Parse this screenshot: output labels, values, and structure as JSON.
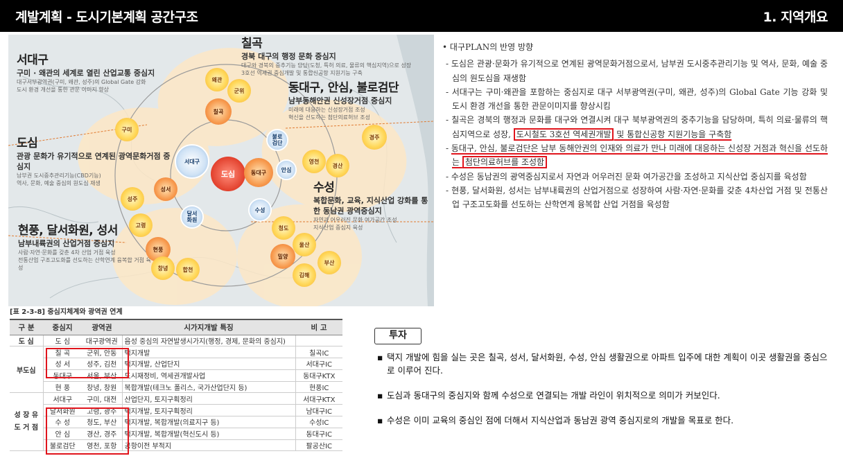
{
  "header": {
    "title": "계발계획 - 도시기본계획 공간구조",
    "section": "1. 지역개요"
  },
  "map": {
    "areas": [
      {
        "title": "서대구",
        "subtitle": "구미 · 왜관의 세계로 열린 산업교통 중심지",
        "notes": [
          "대구서부광역권(구미, 왜관, 성주)의 Global Gate 강화",
          "도시 환경 개선을 통한 관문 이미지 향상"
        ]
      },
      {
        "title": "칠곡",
        "subtitle": "경북 대구의 행정 문화 중심지",
        "notes": [
          "대구와 경북의 중추기능 담당(도청, 특허 의료, 물류의 핵심지역)으로 성장",
          "3호선 역세권 중심개발 및 통합신공항 지원기능 구축"
        ]
      },
      {
        "title": "동대구, 안심, 불로검단",
        "subtitle": "남부동해안권 신성장거점 중심지",
        "notes": [
          "미래에 대응하는 신성장거점 조성",
          "혁신을 선도하는 첨단의료허브 조성"
        ]
      },
      {
        "title": "도심",
        "subtitle": "관광 문화가 유기적으로 연계된 광역문화거점 중심지",
        "notes": [
          "남부권 도시중추관리기능(CBD기능)",
          "역사, 문화, 예술 중심의 원도심 재생"
        ]
      },
      {
        "title": "수성",
        "subtitle": "복합문화, 교육, 지식산업 강화를 통한 동남권 광역중심지",
        "notes": [
          "자연과 어우러진 문화 여가공간 조성",
          "지식산업 중심지 육성"
        ]
      },
      {
        "title": "현풍, 달서화원, 성서",
        "subtitle": "남부내륙권의 산업거점 중심지",
        "notes": [
          "사람·자연·문화를 갖춘 4차 산업 거점 육성",
          "전통산업 구조고도화를 선도하는 산학연계 융복합 거점 육성"
        ]
      }
    ],
    "nodes": {
      "center": "도심",
      "dongdaegu": "동대구",
      "seodaegu": "서대구",
      "chilgok": "칠곡",
      "bulro": "불로\n검단",
      "ansim": "안심",
      "suseong": "수성",
      "dalseo": "달서\n화원",
      "seongseo": "성서",
      "yellow": [
        "왜관",
        "군위",
        "구미",
        "성주",
        "고령",
        "현풍",
        "창녕",
        "합천",
        "영천",
        "경주",
        "경산",
        "포항",
        "울산",
        "김해",
        "부산",
        "청도",
        "밀양",
        "청도2"
      ],
      "yellow_labels": [
        "왜관",
        "군위",
        "칠곡",
        "구미",
        "성주",
        "고령",
        "현풍",
        "창녕",
        "합천",
        "영천",
        "경주",
        "경산",
        "포항",
        "울산",
        "밀양",
        "김해",
        "부산",
        "청도"
      ]
    }
  },
  "table": {
    "caption": "[표 2-3-8]  중심지체계와 광역권 연계",
    "headers": [
      "구 분",
      "중심지",
      "광역권",
      "시가지개발 특징",
      "비 고"
    ],
    "groups": [
      {
        "name": "도 심",
        "rows": [
          [
            "도 심",
            "대구광역권",
            "음성 중심의 자연발생시가지(행정, 경제, 문화의 중심지)",
            ""
          ]
        ]
      },
      {
        "name": "부도심",
        "rows": [
          [
            "칠 곡",
            "군위, 안동",
            "택지개발",
            "칠곡IC"
          ],
          [
            "성 서",
            "성주, 김천",
            "택지개발, 산업단지",
            "서대구IC"
          ],
          [
            "동대구",
            "서울, 부산",
            "도시재정비, 역세권개발사업",
            "동대구KTX"
          ],
          [
            "현 풍",
            "창녕, 창원",
            "복합개발(테크노 폴리스, 국가산업단지 등)",
            "현풍IC"
          ]
        ]
      },
      {
        "name": "성 장 유 도 거 점",
        "rows": [
          [
            "서대구",
            "구미, 대전",
            "산업단지, 토지구획정리",
            "서대구KTX"
          ],
          [
            "달서화원",
            "고령, 광주",
            "택지개발, 토지구획정리",
            "남대구IC"
          ],
          [
            "수 성",
            "청도, 부산",
            "택지개발, 복합개발(의료지구 등)",
            "수성IC"
          ],
          [
            "안 심",
            "경산, 경주",
            "택지개발, 복합개발(혁신도시 등)",
            "동대구IC"
          ],
          [
            "불로검단",
            "영천, 포항",
            "공항이전 부적지",
            "팔공산IC"
          ]
        ]
      }
    ]
  },
  "right": {
    "heading": "대구PLAN의 반영 방향",
    "items": [
      {
        "text": "도심은 관광·문화가 유기적으로 연계된 광역문화거점으로서, 남부권 도시중추관리기능 및 역사, 문화, 예술 중심의 원도심을 재생함"
      },
      {
        "text": "서대구는 구미·왜관을 포함하는 중심지로 대구 서부광역권(구미, 왜관, 성주)의 Global Gate 기능 강화 및 도시 환경 개선을 통한 관문이미지를 향상시킴"
      },
      {
        "pre": "칠곡은 경북의 행정과 문화를 대구와 연결시켜 대구 북부광역권의 중추기능을 담당하며, 특히 의료·물류의 핵심지역으로 성장, ",
        "hl": "도시철도 3호선 역세권개발",
        "mid": " 및 통합신공항 지원기능을 구축함"
      },
      {
        "pre": "동대구, 안심, 불로검단은 남부 동해안권의 인재와 의료가 만나 미래에 대응하는 신성장 거점과 혁신을 선도하는 ",
        "hl": "첨단의료허브를 조성함"
      },
      {
        "text": "수성은 동남권의 광역중심지로서 자연과 어우러진 문화 여가공간을 조성하고 지식산업 중심지를 육성함"
      },
      {
        "text": "현풍, 달서화원, 성서는 남부내륙권의 산업거점으로 성장하여 사람·자연·문화를 갖춘 4차산업 거점 및 전통산업 구조고도화를 선도하는 산학연계 융복합 산업 거점을 육성함"
      }
    ]
  },
  "invest": {
    "label": "투자",
    "bullets": [
      "택지 개발에 힘을 실는 곳은 칠곡, 성서, 달서화원, 수성, 안심 생활권으로 아파트 입주에 대한 계획이 이곳 생활권을 중심으로 이루어 진다.",
      "도심과 동대구의 중심지와 함께 수성으로 연결되는 개발 라인이 위치적으로 의미가 커보인다.",
      "수성은 이미 교육의 중심인 점에 더해서 지식산업과 동남권 광역 중심지로의 개발을 목표로 한다."
    ]
  },
  "colors": {
    "accent_red": "#e0141c",
    "header_bg": "#000000"
  }
}
